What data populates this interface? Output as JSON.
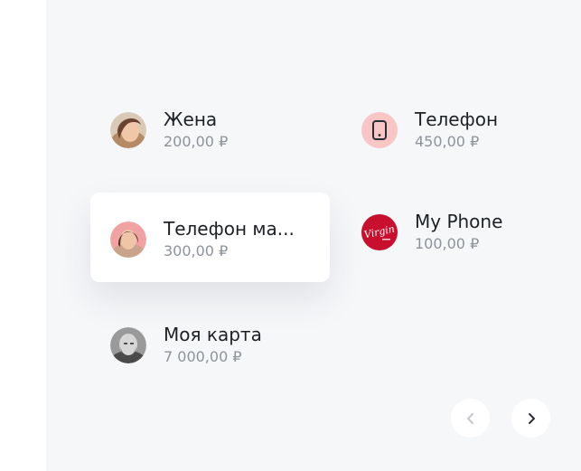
{
  "contacts": [
    {
      "name": "Жена",
      "amount": "200,00 ₽"
    },
    {
      "name": "Телефон ма...",
      "amount": "300,00 ₽"
    },
    {
      "name": "Моя карта",
      "amount": "7 000,00 ₽"
    },
    {
      "name": "Телефон",
      "amount": "450,00 ₽"
    },
    {
      "name": "My Phone",
      "amount": "100,00 ₽",
      "logo_text": "Virgin"
    }
  ],
  "colors": {
    "panel_bg": "#f6f7f9",
    "phone_icon_bg": "#f9c6c6",
    "virgin_red": "#c8102e"
  },
  "icons": {
    "phone": "phone-icon",
    "prev": "chevron-left-icon",
    "next": "chevron-right-icon"
  }
}
